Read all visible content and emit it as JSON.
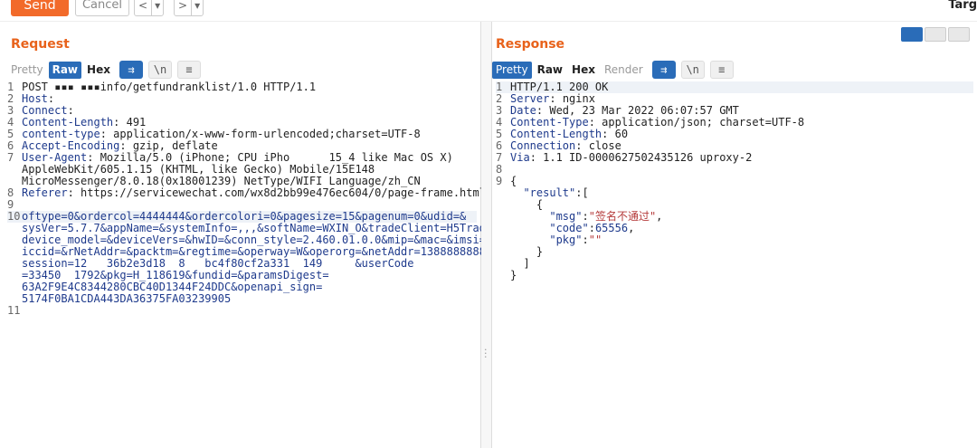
{
  "toolbar": {
    "send_label": "Send",
    "cancel_label": "Cancel",
    "back_label": "<",
    "forward_label": ">",
    "target_label": "Targ"
  },
  "request": {
    "title": "Request",
    "tabs": [
      "Pretty",
      "Raw",
      "Hex"
    ],
    "active_tab": "Raw",
    "tools": [
      "wrap-icon",
      "newline-icon",
      "menu-icon"
    ],
    "tool_glyphs": [
      "⇉",
      "\\n",
      "≡"
    ],
    "lines": [
      {
        "n": "1",
        "text": "POST ▪▪▪ ▪▪▪info/getfundranklist/1.0 HTTP/1.1"
      },
      {
        "n": "2",
        "key": "Host",
        "val": ""
      },
      {
        "n": "3",
        "key": "Connect",
        "val": ""
      },
      {
        "n": "4",
        "key": "Content-Length",
        "val": "491"
      },
      {
        "n": "5",
        "key": "content-type",
        "val": "application/x-www-form-urlencoded;charset=UTF-8"
      },
      {
        "n": "6",
        "key": "Accept-Encoding",
        "val": "gzip, deflate"
      },
      {
        "n": "7",
        "key": "User-Agent",
        "val": "Mozilla/5.0 (iPhone; CPU iPho      15_4 like Mac OS X)"
      },
      {
        "n": "",
        "text": "AppleWebKit/605.1.15 (KHTML, like Gecko) Mobile/15E148"
      },
      {
        "n": "",
        "text": "MicroMessenger/8.0.18(0x18001239) NetType/WIFI Language/zh_CN"
      },
      {
        "n": "8",
        "key": "Referer",
        "val": "https://servicewechat.com/wx8d2bb99e476ec604/0/page-frame.html"
      },
      {
        "n": "9",
        "text": ""
      },
      {
        "n": "10",
        "body": "oftype=0&ordercol=4444444&ordercolori=0&pagesize=15&pagenum=0&udid=&"
      },
      {
        "n": "",
        "body": "sysVer=5.7.7&appName=&systemInfo=,,,&softName=WXIN_O&tradeClient=H5Trade&"
      },
      {
        "n": "",
        "body": "device_model=&deviceVers=&hwID=&conn_style=2.460.01.0.0&mip=&mac=&imsi=&"
      },
      {
        "n": "",
        "body": "iccid=&rNetAddr=&packtm=&regtime=&operway=W&operorg=&netAddr=13888888888&"
      },
      {
        "n": "",
        "body": "session=12   36b2e3d18  8   bc4f80cf2a331  149     &userCode"
      },
      {
        "n": "",
        "body": "=33450  1792&pkg=H_118619&fundid=&paramsDigest="
      },
      {
        "n": "",
        "body": "63A2F9E4C8344280CBC40D1344F24DDC&openapi_sign="
      },
      {
        "n": "",
        "body": "5174F0BA1CDA443DA36375FA03239905"
      },
      {
        "n": "11",
        "text": ""
      }
    ]
  },
  "response": {
    "title": "Response",
    "tabs": [
      "Pretty",
      "Raw",
      "Hex",
      "Render"
    ],
    "active_tab": "Pretty",
    "lines": [
      {
        "n": "1",
        "text": "HTTP/1.1 200 OK"
      },
      {
        "n": "2",
        "key": "Server",
        "val": "nginx"
      },
      {
        "n": "3",
        "key": "Date",
        "val": "Wed, 23 Mar 2022 06:07:57 GMT"
      },
      {
        "n": "4",
        "key": "Content-Type",
        "val": "application/json; charset=UTF-8"
      },
      {
        "n": "5",
        "key": "Content-Length",
        "val": "60"
      },
      {
        "n": "6",
        "key": "Connection",
        "val": "close"
      },
      {
        "n": "7",
        "key": "Via",
        "val": "1.1 ID-0000627502435126 uproxy-2"
      },
      {
        "n": "8",
        "text": ""
      },
      {
        "n": "9",
        "text": "{"
      },
      {
        "n": "",
        "json": [
          "  ",
          "\"result\"",
          ":["
        ]
      },
      {
        "n": "",
        "text": "    {"
      },
      {
        "n": "",
        "json": [
          "      ",
          "\"msg\"",
          ":",
          "\"签名不通过\"",
          ","
        ]
      },
      {
        "n": "",
        "json": [
          "      ",
          "\"code\"",
          ":",
          "65556",
          ","
        ]
      },
      {
        "n": "",
        "json": [
          "      ",
          "\"pkg\"",
          ":",
          "\"\"",
          ""
        ]
      },
      {
        "n": "",
        "text": "    }"
      },
      {
        "n": "",
        "text": "  ]"
      },
      {
        "n": "",
        "text": "}"
      }
    ]
  }
}
